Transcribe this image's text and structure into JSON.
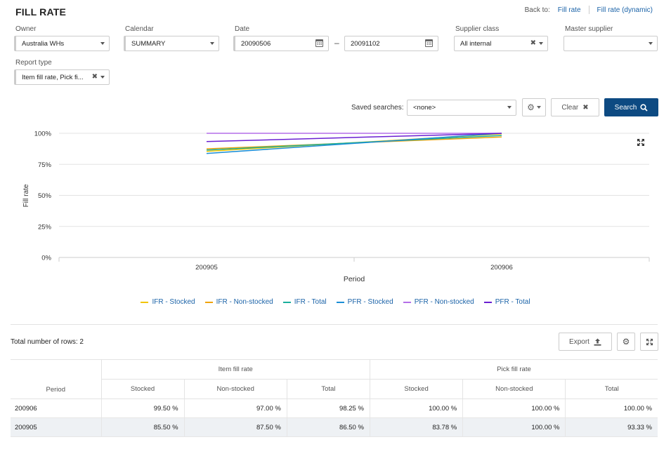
{
  "header": {
    "title": "FILL RATE",
    "back_to_label": "Back to:",
    "back_links": [
      "Fill rate",
      "Fill rate (dynamic)"
    ]
  },
  "filters": {
    "owner": {
      "label": "Owner",
      "value": "Australia WHs"
    },
    "calendar": {
      "label": "Calendar",
      "value": "SUMMARY"
    },
    "date": {
      "label": "Date",
      "from": "20090506",
      "to": "20091102",
      "separator": "–"
    },
    "supplier_class": {
      "label": "Supplier class",
      "value": "All internal"
    },
    "master_supplier": {
      "label": "Master supplier",
      "value": ""
    },
    "report_type": {
      "label": "Report type",
      "value": "Item fill rate, Pick fi..."
    }
  },
  "search_bar": {
    "saved_searches_label": "Saved searches:",
    "saved_searches_value": "<none>",
    "clear_label": "Clear",
    "search_label": "Search"
  },
  "chart_data": {
    "type": "line",
    "title": "",
    "xlabel": "Period",
    "ylabel": "Fill rate",
    "x": [
      "200905",
      "200906"
    ],
    "yticks": [
      "0%",
      "25%",
      "50%",
      "75%",
      "100%"
    ],
    "ylim": [
      0,
      100
    ],
    "grid": true,
    "legend_position": "bottom",
    "series": [
      {
        "name": "IFR - Stocked",
        "color": "#f2c500",
        "values": [
          85.5,
          99.5
        ]
      },
      {
        "name": "IFR - Non-stocked",
        "color": "#f0a30a",
        "values": [
          87.5,
          97.0
        ]
      },
      {
        "name": "IFR - Total",
        "color": "#1aaf9c",
        "values": [
          86.5,
          98.25
        ]
      },
      {
        "name": "PFR - Stocked",
        "color": "#1b8ed6",
        "values": [
          83.78,
          100.0
        ]
      },
      {
        "name": "PFR - Non-stocked",
        "color": "#b46ee8",
        "values": [
          100.0,
          100.0
        ]
      },
      {
        "name": "PFR - Total",
        "color": "#6a1fd1",
        "values": [
          93.33,
          100.0
        ]
      }
    ]
  },
  "table": {
    "total_rows_label": "Total number of rows: 2",
    "export_label": "Export",
    "group_headers": [
      "Item fill rate",
      "Pick fill rate"
    ],
    "period_header": "Period",
    "sub_headers": [
      "Stocked",
      "Non-stocked",
      "Total",
      "Stocked",
      "Non-stocked",
      "Total"
    ],
    "rows": [
      {
        "period": "200906",
        "values": [
          "99.50 %",
          "97.00 %",
          "98.25 %",
          "100.00 %",
          "100.00 %",
          "100.00 %"
        ]
      },
      {
        "period": "200905",
        "values": [
          "85.50 %",
          "87.50 %",
          "86.50 %",
          "83.78 %",
          "100.00 %",
          "93.33 %"
        ]
      }
    ]
  }
}
